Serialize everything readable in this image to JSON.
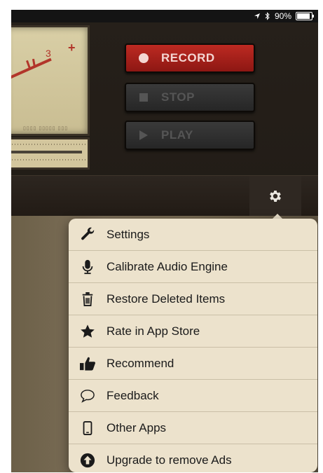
{
  "status_bar": {
    "battery": "90%",
    "battery_level": 0.9
  },
  "transport": {
    "record_label": "RECORD",
    "stop_label": "STOP",
    "play_label": "PLAY"
  },
  "vu_meter": {
    "scale_3": "3",
    "scale_plus": "+"
  },
  "menu": {
    "items": [
      {
        "label": "Settings",
        "icon": "wrench-icon"
      },
      {
        "label": "Calibrate Audio Engine",
        "icon": "microphone-icon"
      },
      {
        "label": "Restore Deleted Items",
        "icon": "trash-icon"
      },
      {
        "label": "Rate in App Store",
        "icon": "star-icon"
      },
      {
        "label": "Recommend",
        "icon": "thumbs-up-icon"
      },
      {
        "label": "Feedback",
        "icon": "speech-bubble-icon"
      },
      {
        "label": "Other Apps",
        "icon": "phone-icon"
      },
      {
        "label": "Upgrade to remove Ads",
        "icon": "upgrade-arrow-icon"
      }
    ]
  },
  "colors": {
    "record_red": "#bd2a22",
    "menu_bg": "#ece2cc",
    "dark_bg": "#231c14"
  }
}
